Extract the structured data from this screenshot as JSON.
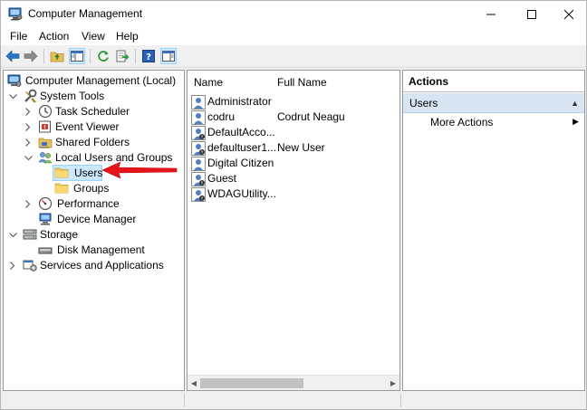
{
  "window": {
    "title": "Computer Management"
  },
  "menu": [
    "File",
    "Action",
    "View",
    "Help"
  ],
  "tree": {
    "root": "Computer Management (Local)",
    "system_tools": "System Tools",
    "task_scheduler": "Task Scheduler",
    "event_viewer": "Event Viewer",
    "shared_folders": "Shared Folders",
    "local_users_groups": "Local Users and Groups",
    "users": "Users",
    "groups": "Groups",
    "performance": "Performance",
    "device_manager": "Device Manager",
    "storage": "Storage",
    "disk_management": "Disk Management",
    "services_apps": "Services and Applications"
  },
  "list": {
    "columns": {
      "name": "Name",
      "full_name": "Full Name"
    },
    "rows": [
      {
        "name": "Administrator",
        "full_name": ""
      },
      {
        "name": "codru",
        "full_name": "Codrut Neagu"
      },
      {
        "name": "DefaultAcco...",
        "full_name": ""
      },
      {
        "name": "defaultuser1...",
        "full_name": "New User"
      },
      {
        "name": "Digital Citizen",
        "full_name": ""
      },
      {
        "name": "Guest",
        "full_name": ""
      },
      {
        "name": "WDAGUtility...",
        "full_name": ""
      }
    ]
  },
  "actions": {
    "title": "Actions",
    "section": "Users",
    "more": "More Actions"
  },
  "colors": {
    "selection_bg": "#cce8ff",
    "actions_section_bg": "#d7e4f1",
    "annotation_arrow": "#e8141b"
  }
}
